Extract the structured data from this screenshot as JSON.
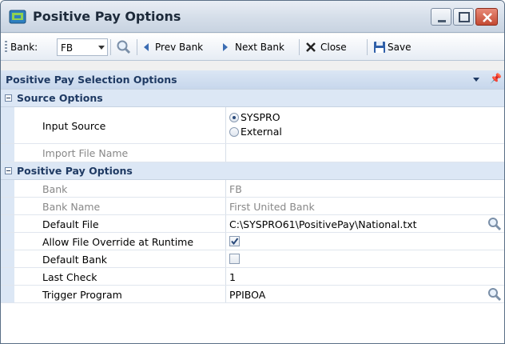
{
  "window": {
    "title": "Positive Pay Options"
  },
  "toolbar": {
    "bank_label": "Bank:",
    "bank_value": "FB",
    "prev_label": "Prev Bank",
    "next_label": "Next Bank",
    "close_label": "Close",
    "save_label": "Save"
  },
  "panel": {
    "title": "Positive Pay Selection Options"
  },
  "source_options": {
    "category": "Source Options",
    "input_source_label": "Input Source",
    "radio_sys": "SYSPRO",
    "radio_ext": "External",
    "selected": "SYSPRO",
    "import_file_label": "Import File Name",
    "import_file_value": ""
  },
  "pp_options": {
    "category": "Positive Pay Options",
    "bank_label": "Bank",
    "bank_value": "FB",
    "bank_name_label": "Bank Name",
    "bank_name_value": "First United Bank",
    "default_file_label": "Default File",
    "default_file_value": "C:\\SYSPRO61\\PositivePay\\National.txt",
    "allow_override_label": "Allow File Override at Runtime",
    "allow_override_checked": true,
    "default_bank_label": "Default Bank",
    "default_bank_checked": false,
    "last_check_label": "Last Check",
    "last_check_value": "1",
    "trigger_label": "Trigger Program",
    "trigger_value": "PPIBOA"
  },
  "colors": {
    "accent": "#1f3a63",
    "category_bg": "#dce7f5"
  }
}
